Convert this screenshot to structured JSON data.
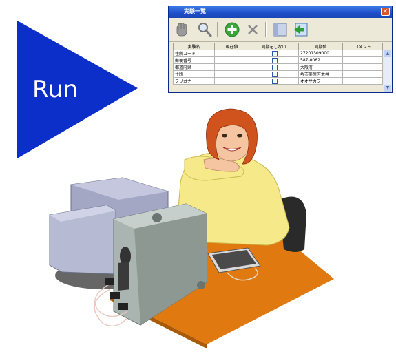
{
  "run": {
    "label": "Run",
    "color": "#0b2fc8"
  },
  "window": {
    "title": "実験一覧",
    "close_label": "✕",
    "toolbar_icons": [
      "hand-icon",
      "search-icon",
      "add-icon",
      "delete-icon",
      "panel-icon",
      "import-icon"
    ],
    "columns": [
      "実験名",
      "現在値",
      "同期をしない",
      "同期値",
      "コメント"
    ],
    "rows": [
      {
        "name": "住所コード",
        "current": "",
        "value": "27201309000",
        "comment": ""
      },
      {
        "name": "郵便番号",
        "current": "",
        "value": "587-0062",
        "comment": ""
      },
      {
        "name": "都道府県",
        "current": "",
        "value": "大阪府",
        "comment": ""
      },
      {
        "name": "住所",
        "current": "",
        "value": "堺市美原区太井",
        "comment": ""
      },
      {
        "name": "フリガナ",
        "current": "",
        "value": "オオサカフ",
        "comment": ""
      }
    ]
  },
  "colors": {
    "desk": "#e07a10",
    "monitor": "#a3a7c4",
    "tower": "#aab4b0",
    "shirt": "#f6e98a",
    "hair": "#d0521c"
  }
}
